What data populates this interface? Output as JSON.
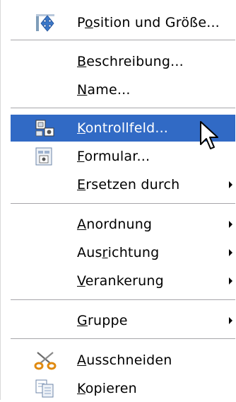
{
  "menu": {
    "items": [
      {
        "label_pre": "P",
        "label_u": "o",
        "label_post": "sition und Größe...",
        "icon": "position-size-icon"
      },
      {
        "label_pre": "",
        "label_u": "B",
        "label_post": "eschreibung...",
        "icon": ""
      },
      {
        "label_pre": "",
        "label_u": "N",
        "label_post": "ame...",
        "icon": ""
      },
      {
        "label_pre": "",
        "label_u": "K",
        "label_post": "ontrollfeld...",
        "icon": "control-field-icon",
        "highlighted": true
      },
      {
        "label_pre": "",
        "label_u": "F",
        "label_post": "ormular...",
        "icon": "form-icon"
      },
      {
        "label_pre": "",
        "label_u": "E",
        "label_post": "rsetzen durch",
        "icon": "",
        "submenu": true
      },
      {
        "label_pre": "",
        "label_u": "A",
        "label_post": "nordnung",
        "icon": "",
        "submenu": true
      },
      {
        "label_pre": "Aus",
        "label_u": "r",
        "label_post": "ichtung",
        "icon": "",
        "submenu": true
      },
      {
        "label_pre": "",
        "label_u": "V",
        "label_post": "erankerung",
        "icon": "",
        "submenu": true
      },
      {
        "label_pre": "",
        "label_u": "G",
        "label_post": "ruppe",
        "icon": "",
        "submenu": true
      },
      {
        "label_pre": "",
        "label_u": "A",
        "label_post": "usschneiden",
        "icon": "scissors-icon"
      },
      {
        "label_pre": "",
        "label_u": "K",
        "label_post": "opieren",
        "icon": "copy-icon"
      }
    ]
  },
  "colors": {
    "highlight": "#316ac5",
    "separator": "#a7a6aa"
  }
}
